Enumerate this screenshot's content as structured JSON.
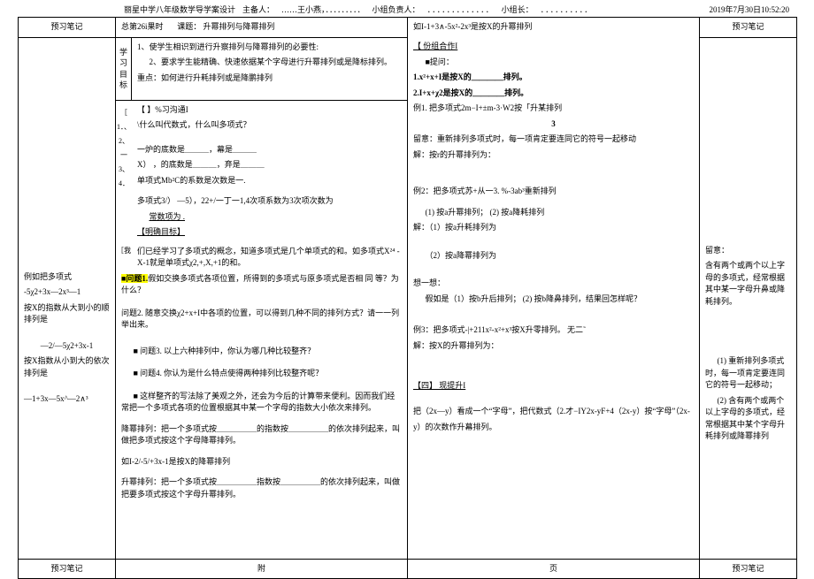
{
  "header": {
    "school_course": "丽星中学八年级数学导学案设计",
    "host_label": "主备人：",
    "host_val": "……王小燕，．．．．．．．．．",
    "grp_leader_label": "小组负责人：",
    "grp_leader_val": "．．．．．．．．．．．．．",
    "team_leader_label": "小组长：",
    "team_leader_val": "．．．．．．．．．．",
    "datetime": "2019年7月30日10:52:20"
  },
  "colheads": {
    "l": "预习笔记",
    "r": "预习笔记"
  },
  "title_row": {
    "period": "总第26i果时",
    "subject_label": "课题：",
    "subject": "升幂排列与降幂排列"
  },
  "goals": {
    "vlabel": "学习目标",
    "g1": "1、使学生相识到进行升察排列与降幂排列的必要性:",
    "g2": "2、要求学生能精确、快速依据某个字母进行升幂排列或是降标排列。",
    "g3": "重点：如何进行升耗排列或是降鹏排列"
  },
  "review": {
    "vnums": "［ 1．、 2、 一 3、 4．",
    "title": "【 】%习沟通I",
    "q1": "\\什么叫代数式，什么叫多项式？",
    "q2": "一炉的底数是＿＿＿，幕是＿＿＿",
    "q3": "X） ，的底数是＿＿＿，弃是＿＿＿",
    "q4": "单项式Mb²C的系数是次数是一.",
    "q5": "多项式3/） —5），22+/一丁一1,4次项系数为3次项次数为",
    "q6": "常数项为 .",
    "link": "【明确目标】",
    "para1": "们已经学习了多项式的概念，知道多项式是几个单项式的和。如多项式X²⁴ -X-1就是单项式χ2,+,X,+1的和。",
    "wenti1_label": "■问题1.",
    "wenti1": "假如交换多项式各项位置，所得到的多项式与原多项式是否相 同        等？为什么？",
    "wenti2": "问题2. 随意交换χ2+x+I中各项的位置，可以得到几种不同的排列方式？请一一列举出来。",
    "wenti3": "■    问题3. 以上六种排列中，你认为哪几种比较整齐？",
    "wenti4": "■    问题4. 你认为是什么特点使得两种排列比较整齐呢？",
    "wenti5": "■    这样整齐的写法除了美观之外，还会为今后的计算带来便利。因而我们经常把一个多项式各项的位置根据其中某一个字母的指数大小依次来排列。",
    "jiangmi": "降幂排列：把一个多项式按＿＿＿＿＿的指数按＿＿＿＿＿的依次排列起来，叫做把多项式按这个字母降幂排列。",
    "ex1": "如I-2/-5/+3x-1是按X的降幂排列",
    "shengmi": "升幂排列：把一个多项式按＿＿＿＿＿指数按＿＿＿＿＿的依次排列起来，叫做把要多项式按这个字母升幂排列。"
  },
  "left_notes": {
    "n1": "例如把多项式",
    "n2": "-5χ2+3x—2x³—1",
    "n3": "按X的指数从大到小的顺排列是",
    "n4": "—2/—5χ2+3x-1",
    "n5": "按X指数从小到大的依次排列是",
    "n6": "—1+3x—5x^—2∧³"
  },
  "right_main": {
    "p0": "如I-1+3∧-5x²-2x³是按X的升幂排列",
    "link3": "【 份组合作I",
    "p1": "■提问：",
    "p2": "1.x²+x+I是按X的＿＿＿＿排列。",
    "p3": "2.I+x+χ2是按X的＿＿＿＿排列。",
    "p4": "例1. 把多项式2m−I+±m-3·W2按「升某排列",
    "p4b": "3",
    "p5": "留意：重新排列多项式时，每一项肯定要连同它的符号一起移动",
    "p6": "解：按r的升幂排列为：",
    "p7": "例2：把多项式苏+从一3. %-3ab³重新排列",
    "p7a": "(1)   按a升幂排列；            (2)  按a降耗排列",
    "p7b": "解：（1）按a升耗排列为",
    "p7c": "（2）按a降幂排列为",
    "p8": "想一想：",
    "p8a": "假如是（1）按b升后排列；             (2)  按b降鼻排列，结果回怎样呢？",
    "p9": "例3：把多项式-|+211x²-x²+x³按X升零排列。                              无二˜",
    "p9a": "解：按X的升幂排列为：",
    "link4": "【四】 现提升I",
    "p10": "把（2x—y）看成一个“字母”，把代数式（2.才−IY2x-yF+4（2x-y）按“字母”（2x-y）的次数作升幕排列。"
  },
  "right_notes": {
    "n1": "留意：",
    "n2": "含有两个或两个以上字母的多项式，经常根据其中某一字母升鼻或降耗排列。",
    "n3": "(1) 重新排列多项式时，每一项肯定要连同它的符号一起移动；",
    "n4": "(2) 含有两个或两个以上字母的多项式，经常根据其中某个字母升耗排列或降幂排列"
  },
  "footer": {
    "l": "预习笔记",
    "m": "附",
    "m2": "页",
    "r": "预习笔记"
  }
}
